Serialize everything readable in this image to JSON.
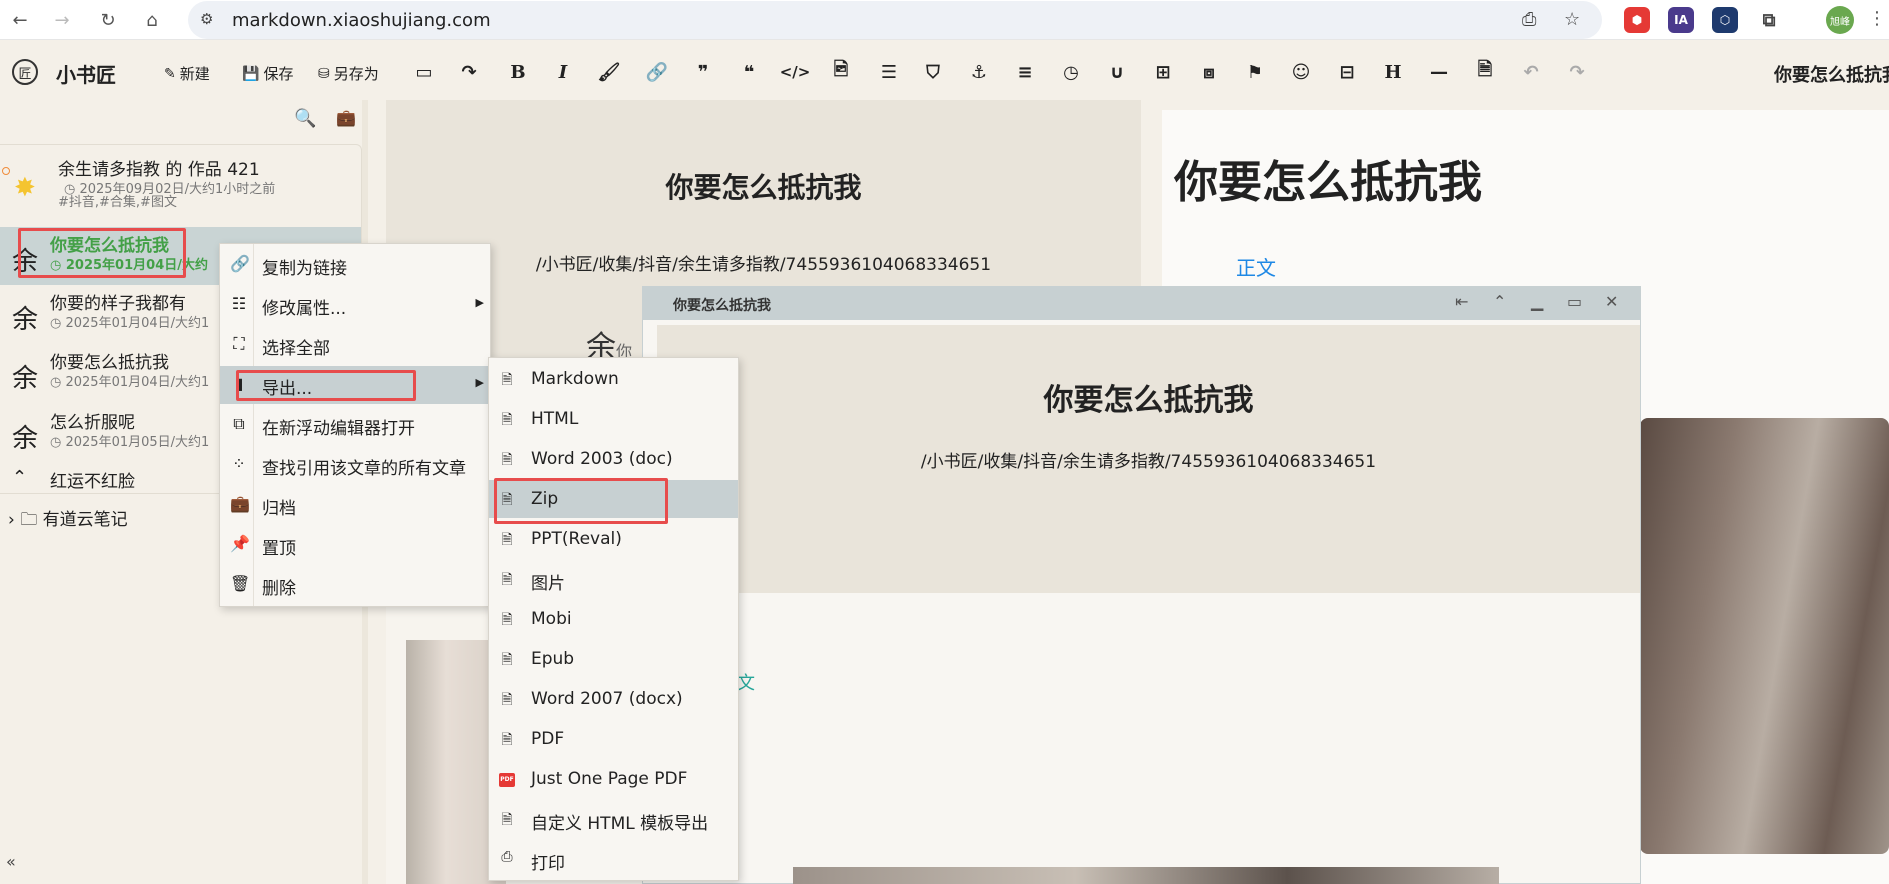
{
  "browser": {
    "url": "markdown.xiaoshujiang.com",
    "profile_label": "旭峰",
    "ext_ia": "IA"
  },
  "toolbar": {
    "brand": "小书匠",
    "new_label": "新建",
    "save_label": "保存",
    "save_as_label": "另存为",
    "doc_title": "你要怎么抵抗我"
  },
  "sidebar": {
    "items": [
      {
        "title": "余生请多指教 的 作品 421",
        "meta": "2025年09月02日/大约1小时之前",
        "tags": "#抖音,#合集,#图文"
      },
      {
        "avatar": "余",
        "title": "你要怎么抵抗我",
        "meta": "2025年01月04日/大约"
      },
      {
        "avatar": "余",
        "title": "你要的样子我都有",
        "meta": "2025年01月04日/大约1"
      },
      {
        "avatar": "余",
        "title": "你要怎么抵抗我",
        "meta": "2025年01月04日/大约1"
      },
      {
        "avatar": "余",
        "title": "怎么折服呢",
        "meta": "2025年01月05日/大约1"
      },
      {
        "avatar": "",
        "title": "红运不红脸",
        "meta": ""
      }
    ],
    "folder": "有道云笔记",
    "collapse": "«"
  },
  "editor": {
    "title": "你要怎么抵抗我",
    "path": "/小书匠/收集/抖音/余生请多指教/7455936104068334651",
    "avatar": "余",
    "partial": "你"
  },
  "preview": {
    "title": "你要怎么抵抗我",
    "link": "正文"
  },
  "float_window": {
    "title": "你要怎么抵抗我",
    "header_title": "你要怎么抵抗我",
    "path": "/小书匠/收集/抖音/余生请多指教/7455936104068334651",
    "partial_text": "文"
  },
  "context_menu": {
    "items": [
      {
        "label": "复制为链接"
      },
      {
        "label": "修改属性..."
      },
      {
        "label": "选择全部"
      },
      {
        "label": "导出..."
      },
      {
        "label": "在新浮动编辑器打开"
      },
      {
        "label": "查找引用该文章的所有文章"
      },
      {
        "label": "归档"
      },
      {
        "label": "置顶"
      },
      {
        "label": "删除"
      }
    ]
  },
  "export_menu": {
    "items": [
      {
        "label": "Markdown"
      },
      {
        "label": "HTML"
      },
      {
        "label": "Word 2003 (doc)"
      },
      {
        "label": "Zip"
      },
      {
        "label": "PPT(Reval)"
      },
      {
        "label": "图片"
      },
      {
        "label": "Mobi"
      },
      {
        "label": "Epub"
      },
      {
        "label": "Word 2007 (docx)"
      },
      {
        "label": "PDF"
      },
      {
        "label": "Just One Page PDF",
        "badge": "PDF"
      },
      {
        "label": "自定义 HTML 模板导出"
      },
      {
        "label": "打印"
      }
    ]
  }
}
